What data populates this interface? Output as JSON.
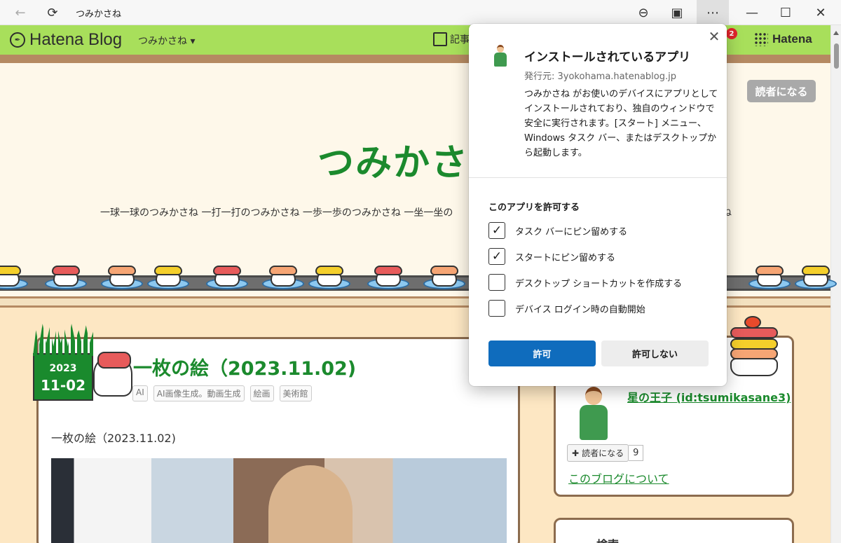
{
  "browser": {
    "tab_title": "つみかさね"
  },
  "hatena_bar": {
    "logo_text": "Hatena Blog",
    "blog_menu": "つみかさね ▾",
    "edit_label": "記事",
    "notification_count": "2",
    "hatena_label": "Hatena"
  },
  "blog": {
    "reader_button": "読者になる",
    "title": "つみかさ",
    "description": "一球一球のつみかさね 一打一打のつみかさね 一歩一歩のつみかさね 一坐一坐の",
    "description_tail": "ね"
  },
  "article": {
    "date_year": "2023",
    "date_day": "11-02",
    "title": "一枚の絵（2023.11.02)",
    "tags": [
      "AI",
      "AI画像生成。動画生成",
      "絵画",
      "美術館"
    ],
    "first_line": "一枚の絵（2023.11.02)"
  },
  "sidebar": {
    "profile_name": "星の王子 (id:tsumikasane3)",
    "reader_button": "読者になる",
    "reader_count": "9",
    "about_link": "このブログについて",
    "next_title": "検索"
  },
  "dialog": {
    "title": "インストールされているアプリ",
    "publisher": "発行元: 3yokohama.hatenablog.jp",
    "description_lines": [
      "つみかさね がお使いのデバイスにアプリとして",
      "インストールされており、独自のウィンドウで",
      "安全に実行されます。[スタート] メニュー、",
      "Windows タスク バー、またはデスクトップか",
      "ら起動します。"
    ],
    "section_title": "このアプリを許可する",
    "options": [
      {
        "label": "タスク バーにピン留めする",
        "checked": true
      },
      {
        "label": "スタートにピン留めする",
        "checked": true
      },
      {
        "label": "デスクトップ ショートカットを作成する",
        "checked": false
      },
      {
        "label": "デバイス ログイン時の自動開始",
        "checked": false
      }
    ],
    "allow_button": "許可",
    "deny_button": "許可しない"
  },
  "colors": {
    "hatena_green": "#a8df5b",
    "blog_green": "#1b8a2d",
    "primary_blue": "#0f6cbd"
  }
}
